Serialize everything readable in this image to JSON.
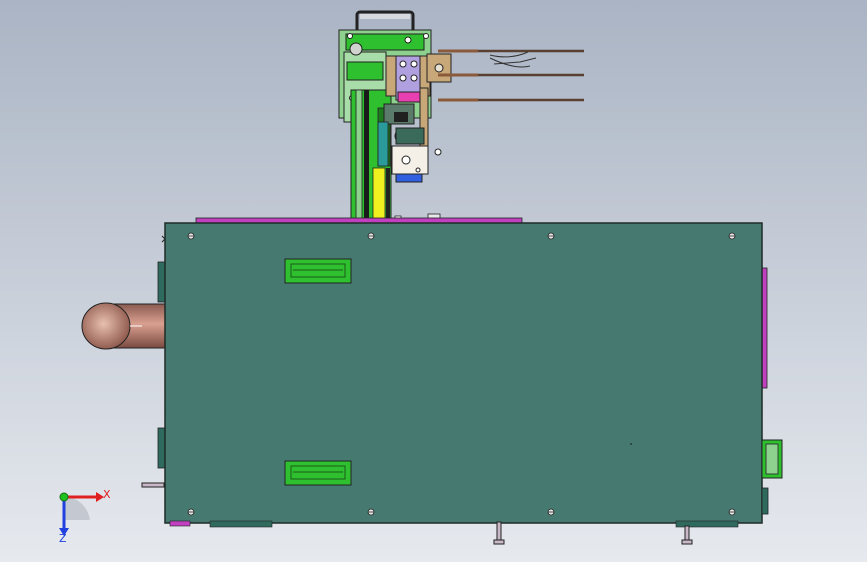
{
  "viewport": {
    "background_top": "#aab4c4",
    "background_bottom": "#e6e9ee"
  },
  "model": {
    "colors": {
      "base_plate": "#467a70",
      "outline": "#1e2a26",
      "magenta_strip": "#c040c0",
      "pipe": "#b4786a",
      "green_part": "#2ec02e",
      "light_green": "#8ed08e",
      "yellow_rail": "#f0f020",
      "tan_bracket": "#c8a878",
      "pink_block": "#e840b0",
      "purple_part": "#b0a0e0",
      "teal_part": "#2a9a9a",
      "blue_part": "#3060e0",
      "white_block": "#f4f0e8",
      "cable": "#5a4030"
    },
    "icons": [
      "base-plate-icon",
      "handle-icon",
      "pipe-icon",
      "valve-icon",
      "screw-icon"
    ]
  },
  "triad": {
    "x_label": "X",
    "z_label": "Z",
    "x_color": "#e02020",
    "z_color": "#2040e0",
    "origin_color": "#20c020"
  }
}
